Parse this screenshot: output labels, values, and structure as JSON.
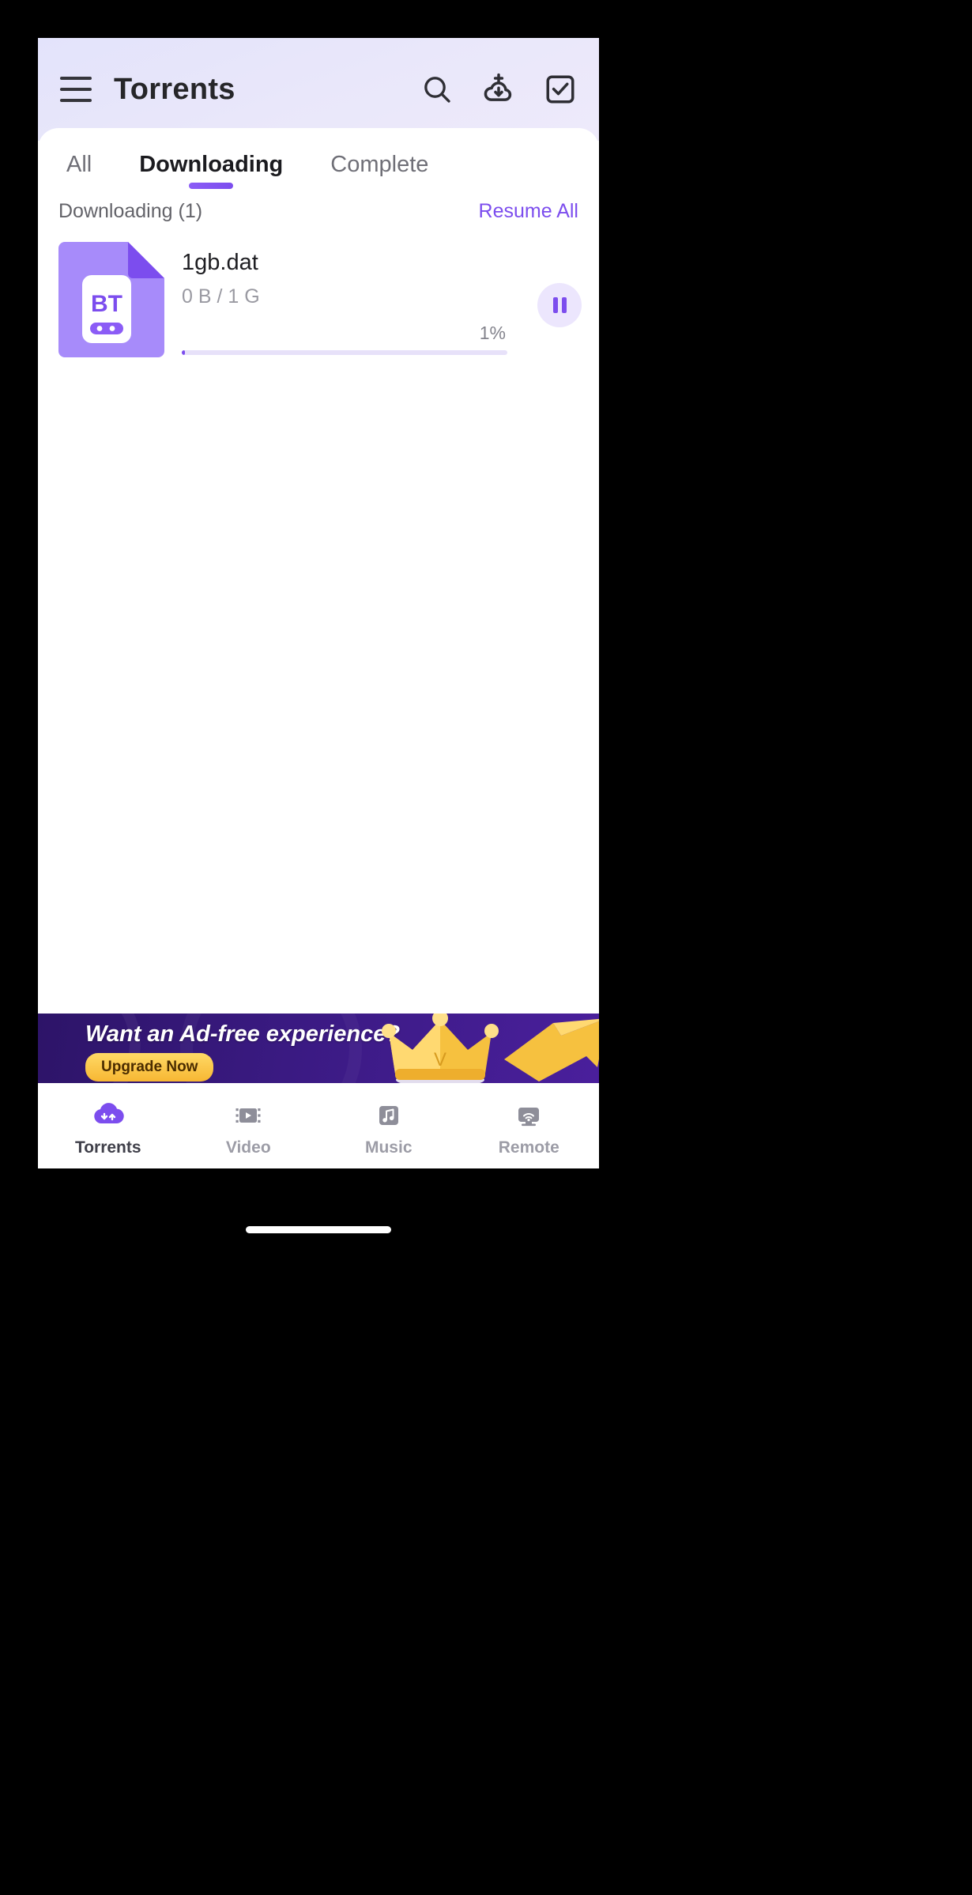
{
  "header": {
    "title": "Torrents",
    "menu_icon": "hamburger-menu-icon",
    "actions": [
      {
        "name": "search-icon",
        "label": "Search"
      },
      {
        "name": "add-torrent-icon",
        "label": "Add torrent"
      },
      {
        "name": "select-checkbox-icon",
        "label": "Select"
      }
    ]
  },
  "tabs": [
    {
      "label": "All",
      "active": false
    },
    {
      "label": "Downloading",
      "active": true
    },
    {
      "label": "Complete",
      "active": false
    }
  ],
  "section": {
    "label": "Downloading (1)",
    "action_label": "Resume All"
  },
  "torrents": [
    {
      "name": "1gb.dat",
      "size": "0 B / 1 G",
      "progress_label": "1%",
      "progress_value": 1,
      "icon_text": "BT",
      "action_icon": "pause-icon"
    }
  ],
  "ad": {
    "headline": "Want an Ad-free experience?",
    "cta_label": "Upgrade Now"
  },
  "bottom_nav": [
    {
      "label": "Torrents",
      "icon": "torrents-icon",
      "active": true
    },
    {
      "label": "Video",
      "icon": "video-icon",
      "active": false
    },
    {
      "label": "Music",
      "icon": "music-icon",
      "active": false
    },
    {
      "label": "Remote",
      "icon": "remote-icon",
      "active": false
    }
  ],
  "colors": {
    "accent": "#7c4dee",
    "header_gradient_start": "#e3e3fb",
    "header_gradient_end": "#eeeafb",
    "progress_track": "#e7e1f9",
    "ad_background": "#3a1a82",
    "cta_gold": "#f7b733"
  }
}
